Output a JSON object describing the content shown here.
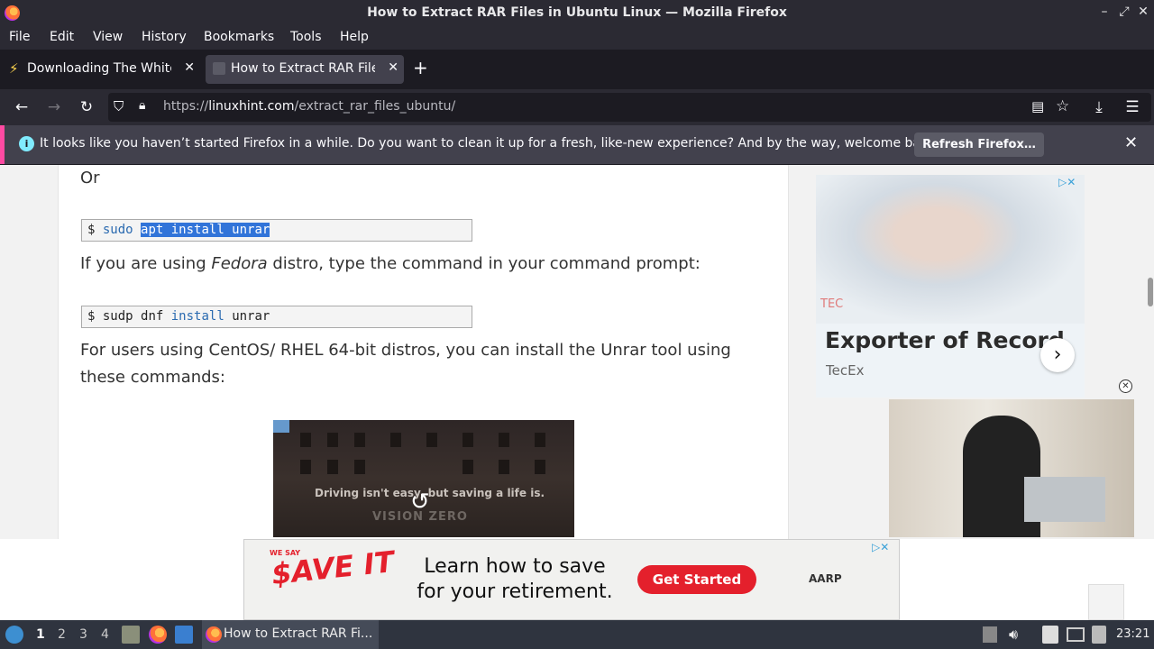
{
  "window": {
    "title": "How to Extract RAR Files in Ubuntu Linux — Mozilla Firefox"
  },
  "menu": {
    "items": [
      "File",
      "Edit",
      "View",
      "History",
      "Bookmarks",
      "Tools",
      "Help"
    ]
  },
  "tabs": [
    {
      "label": "Downloading The White H",
      "active": false
    },
    {
      "label": "How to Extract RAR Files",
      "active": true
    }
  ],
  "navbar": {
    "url_prefix": "https://",
    "url_domain": "linuxhint.com",
    "url_path": "/extract_rar_files_ubuntu/"
  },
  "notification": {
    "message": "It looks like you haven’t started Firefox in a while. Do you want to clean it up for a fresh, like-new experience? And by the way, welcome back!",
    "button": "Refresh Firefox…"
  },
  "article": {
    "or_text": "Or",
    "code1": {
      "prompt": "$",
      "cmd": "sudo",
      "selected": "apt install unrar"
    },
    "fedora_pre": "If you are using ",
    "fedora_em": "Fedora",
    "fedora_post": " distro, type the command in your command prompt:",
    "code2": {
      "prompt": "$",
      "cmd1": "sudp dnf",
      "kw": "install",
      "cmd2": "unrar"
    },
    "centos_text": "For users using CentOS/ RHEL 64-bit distros, you can install the Unrar tool using these commands:",
    "video_text": "Driving isn't easy, but saving a life is.",
    "video_brand": "VISION ZERO"
  },
  "side_ad": {
    "logo": "TEC",
    "headline": "Exporter of Record",
    "brand": "TecEx"
  },
  "bottom_ad": {
    "tag": "WE SAY",
    "logo": "$AVE IT",
    "headline": "Learn how to save for your retirement.",
    "cta": "Get Started",
    "sponsor": "AARP"
  },
  "taskbar": {
    "workspaces": [
      "1",
      "2",
      "3",
      "4"
    ],
    "active_window": "How to Extract RAR Fi...",
    "clock": "23:21"
  }
}
